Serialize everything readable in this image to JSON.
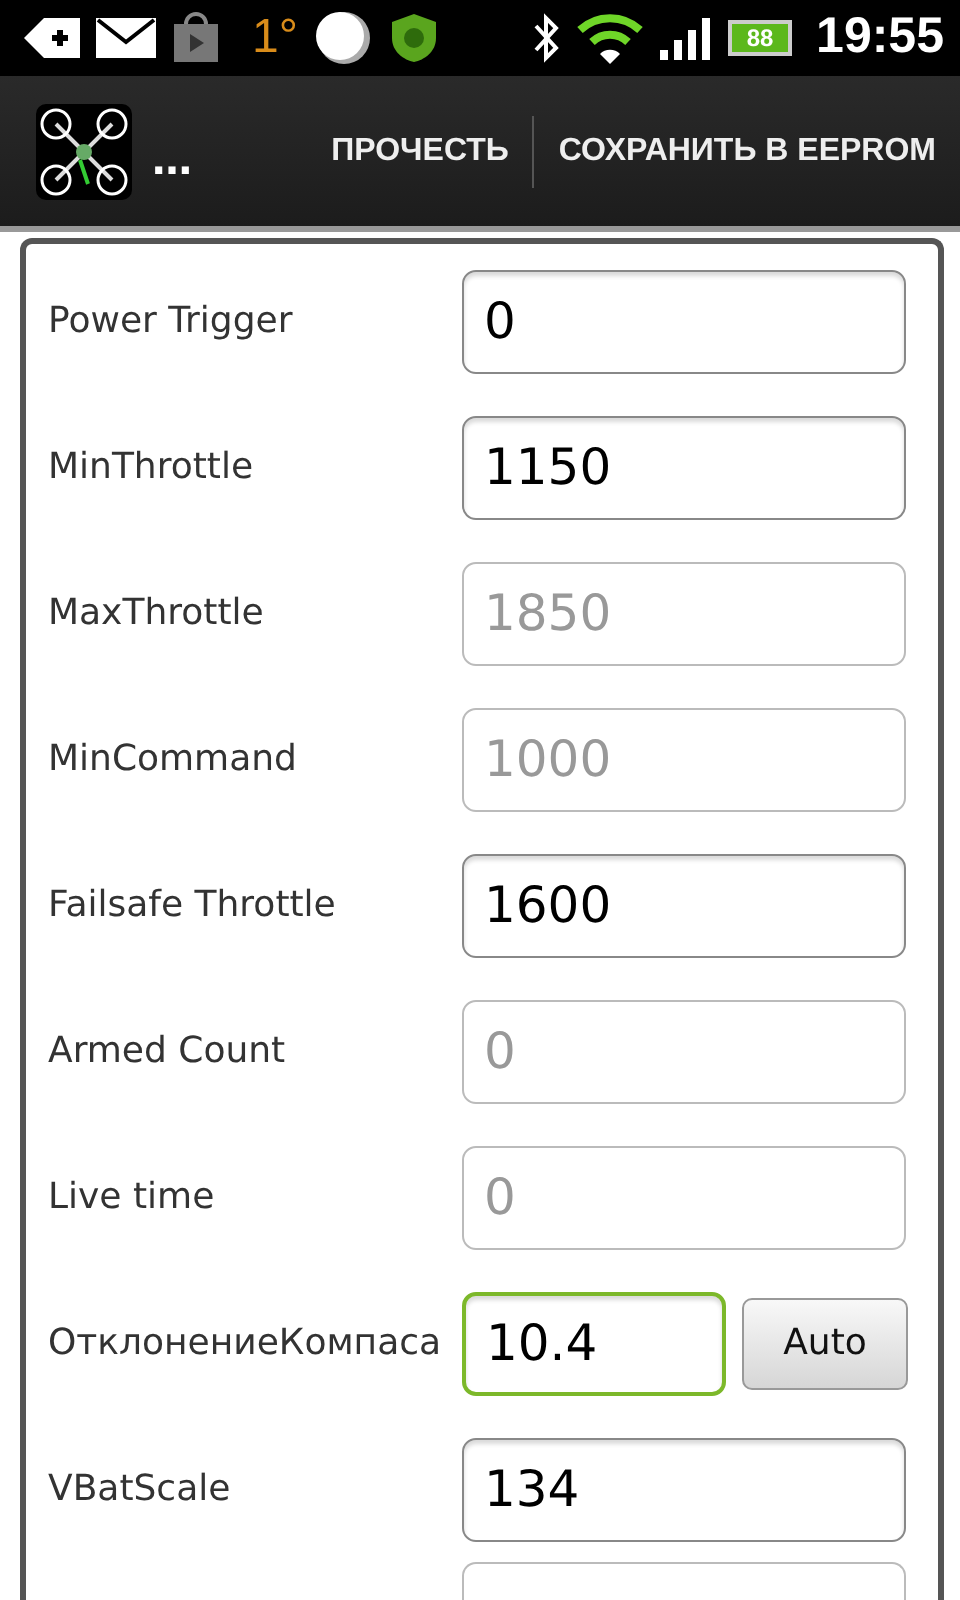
{
  "status_bar": {
    "temperature": "1°",
    "battery": "88",
    "time": "19:55"
  },
  "action_bar": {
    "title": "…",
    "actions": [
      "ПРОЧЕСТЬ",
      "СОХРАНИТЬ В EEPROM"
    ]
  },
  "settings": [
    {
      "label": "Power Trigger",
      "value": "0",
      "disabled": false,
      "focused": false
    },
    {
      "label": "MinThrottle",
      "value": "1150",
      "disabled": false,
      "focused": false
    },
    {
      "label": "MaxThrottle",
      "value": "1850",
      "disabled": true,
      "focused": false
    },
    {
      "label": "MinCommand",
      "value": "1000",
      "disabled": true,
      "focused": false
    },
    {
      "label": "Failsafe Throttle",
      "value": "1600",
      "disabled": false,
      "focused": false
    },
    {
      "label": "Armed Count",
      "value": "0",
      "disabled": true,
      "focused": false
    },
    {
      "label": "Live time",
      "value": "0",
      "disabled": true,
      "focused": false
    },
    {
      "label": "ОтклонениеКомпаса",
      "value": "10.4",
      "disabled": false,
      "focused": true,
      "button": "Auto"
    },
    {
      "label": "VBatScale",
      "value": "134",
      "disabled": false,
      "focused": false
    }
  ]
}
